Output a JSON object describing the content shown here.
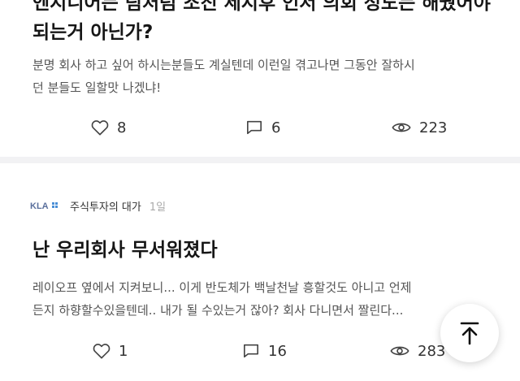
{
  "posts": [
    {
      "title_line1": "엔지니어는 팀처럼 조진 세지후 인서 의회 정도는 해줬어야",
      "title_line2": "되는거 아닌가?",
      "excerpt_line1": "분명 회사 하고 싶어 하시는분들도 계실텐데 이런일 겪고나면 그동안 잘하시",
      "excerpt_line2": "던 분들도 일할맛 나겠냐!",
      "stats": {
        "likes": "8",
        "comments": "6",
        "views": "223"
      }
    },
    {
      "author": {
        "logo_text": "KLA",
        "name": "주식투자의 대가",
        "time": "1일"
      },
      "title": "난 우리회사 무서워졌다",
      "excerpt_line1": "레이오프 옆에서 지켜보니... 이게 반도체가 백날천날 흥할것도 아니고 언제",
      "excerpt_line2": "든지 하향할수있을텐데.. 내가 될 수있는거 잖아? 회사 다니면서 짤린다...",
      "stats": {
        "likes": "1",
        "comments": "16",
        "views": "283"
      }
    }
  ],
  "icons": {
    "like": "heart-outline-icon",
    "comment": "speech-bubble-icon",
    "views": "eye-icon",
    "scroll_top": "arrow-up-icon"
  }
}
